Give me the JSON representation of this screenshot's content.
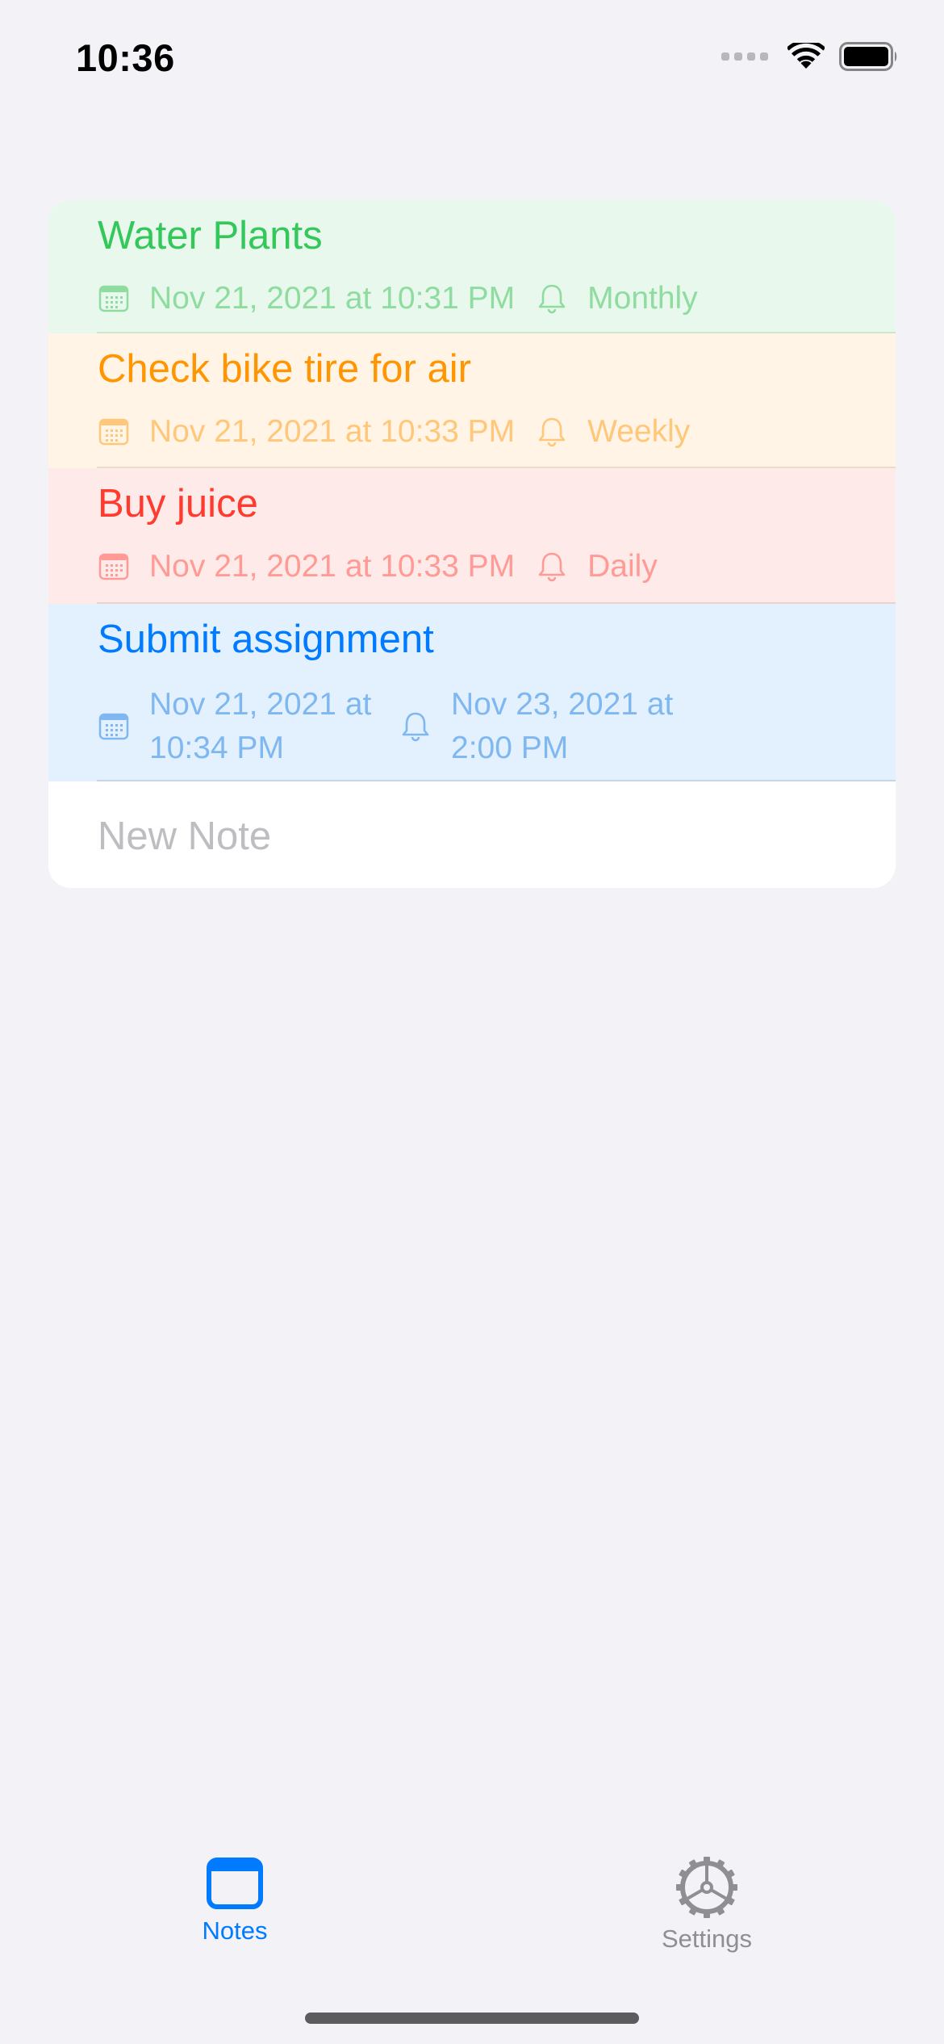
{
  "status_bar": {
    "time": "10:36"
  },
  "notes": [
    {
      "title": "Water Plants",
      "date": "Nov 21, 2021 at 10:31 PM",
      "reminder": "Monthly",
      "title_color": "#34c759",
      "meta_color": "#8fdca0",
      "bg_color": "#e8f8ec"
    },
    {
      "title": "Check bike tire for air",
      "date": "Nov 21, 2021 at 10:33 PM",
      "reminder": "Weekly",
      "title_color": "#ff9500",
      "meta_color": "#ffc77a",
      "bg_color": "#fff4e6"
    },
    {
      "title": "Buy juice",
      "date": "Nov 21, 2021 at 10:33 PM",
      "reminder": "Daily",
      "title_color": "#ff3b30",
      "meta_color": "#ff9a94",
      "bg_color": "#ffeaea"
    },
    {
      "title": "Submit assignment",
      "date_line1": "Nov 21, 2021 at",
      "date_line2": "10:34 PM",
      "reminder_line1": "Nov 23, 2021 at",
      "reminder_line2": "2:00 PM",
      "title_color": "#007aff",
      "meta_color": "#7fb8f0",
      "bg_color": "#e3f0fd"
    }
  ],
  "new_note_placeholder": "New Note",
  "icons": {
    "date": "calendar-icon",
    "reminder": "bell-icon"
  },
  "tab_bar": {
    "tabs": [
      {
        "label": "Notes",
        "icon": "notes-window-icon",
        "selected": true,
        "color": "#007aff"
      },
      {
        "label": "Settings",
        "icon": "gear-icon",
        "selected": false,
        "color": "#8e8e93"
      }
    ]
  }
}
